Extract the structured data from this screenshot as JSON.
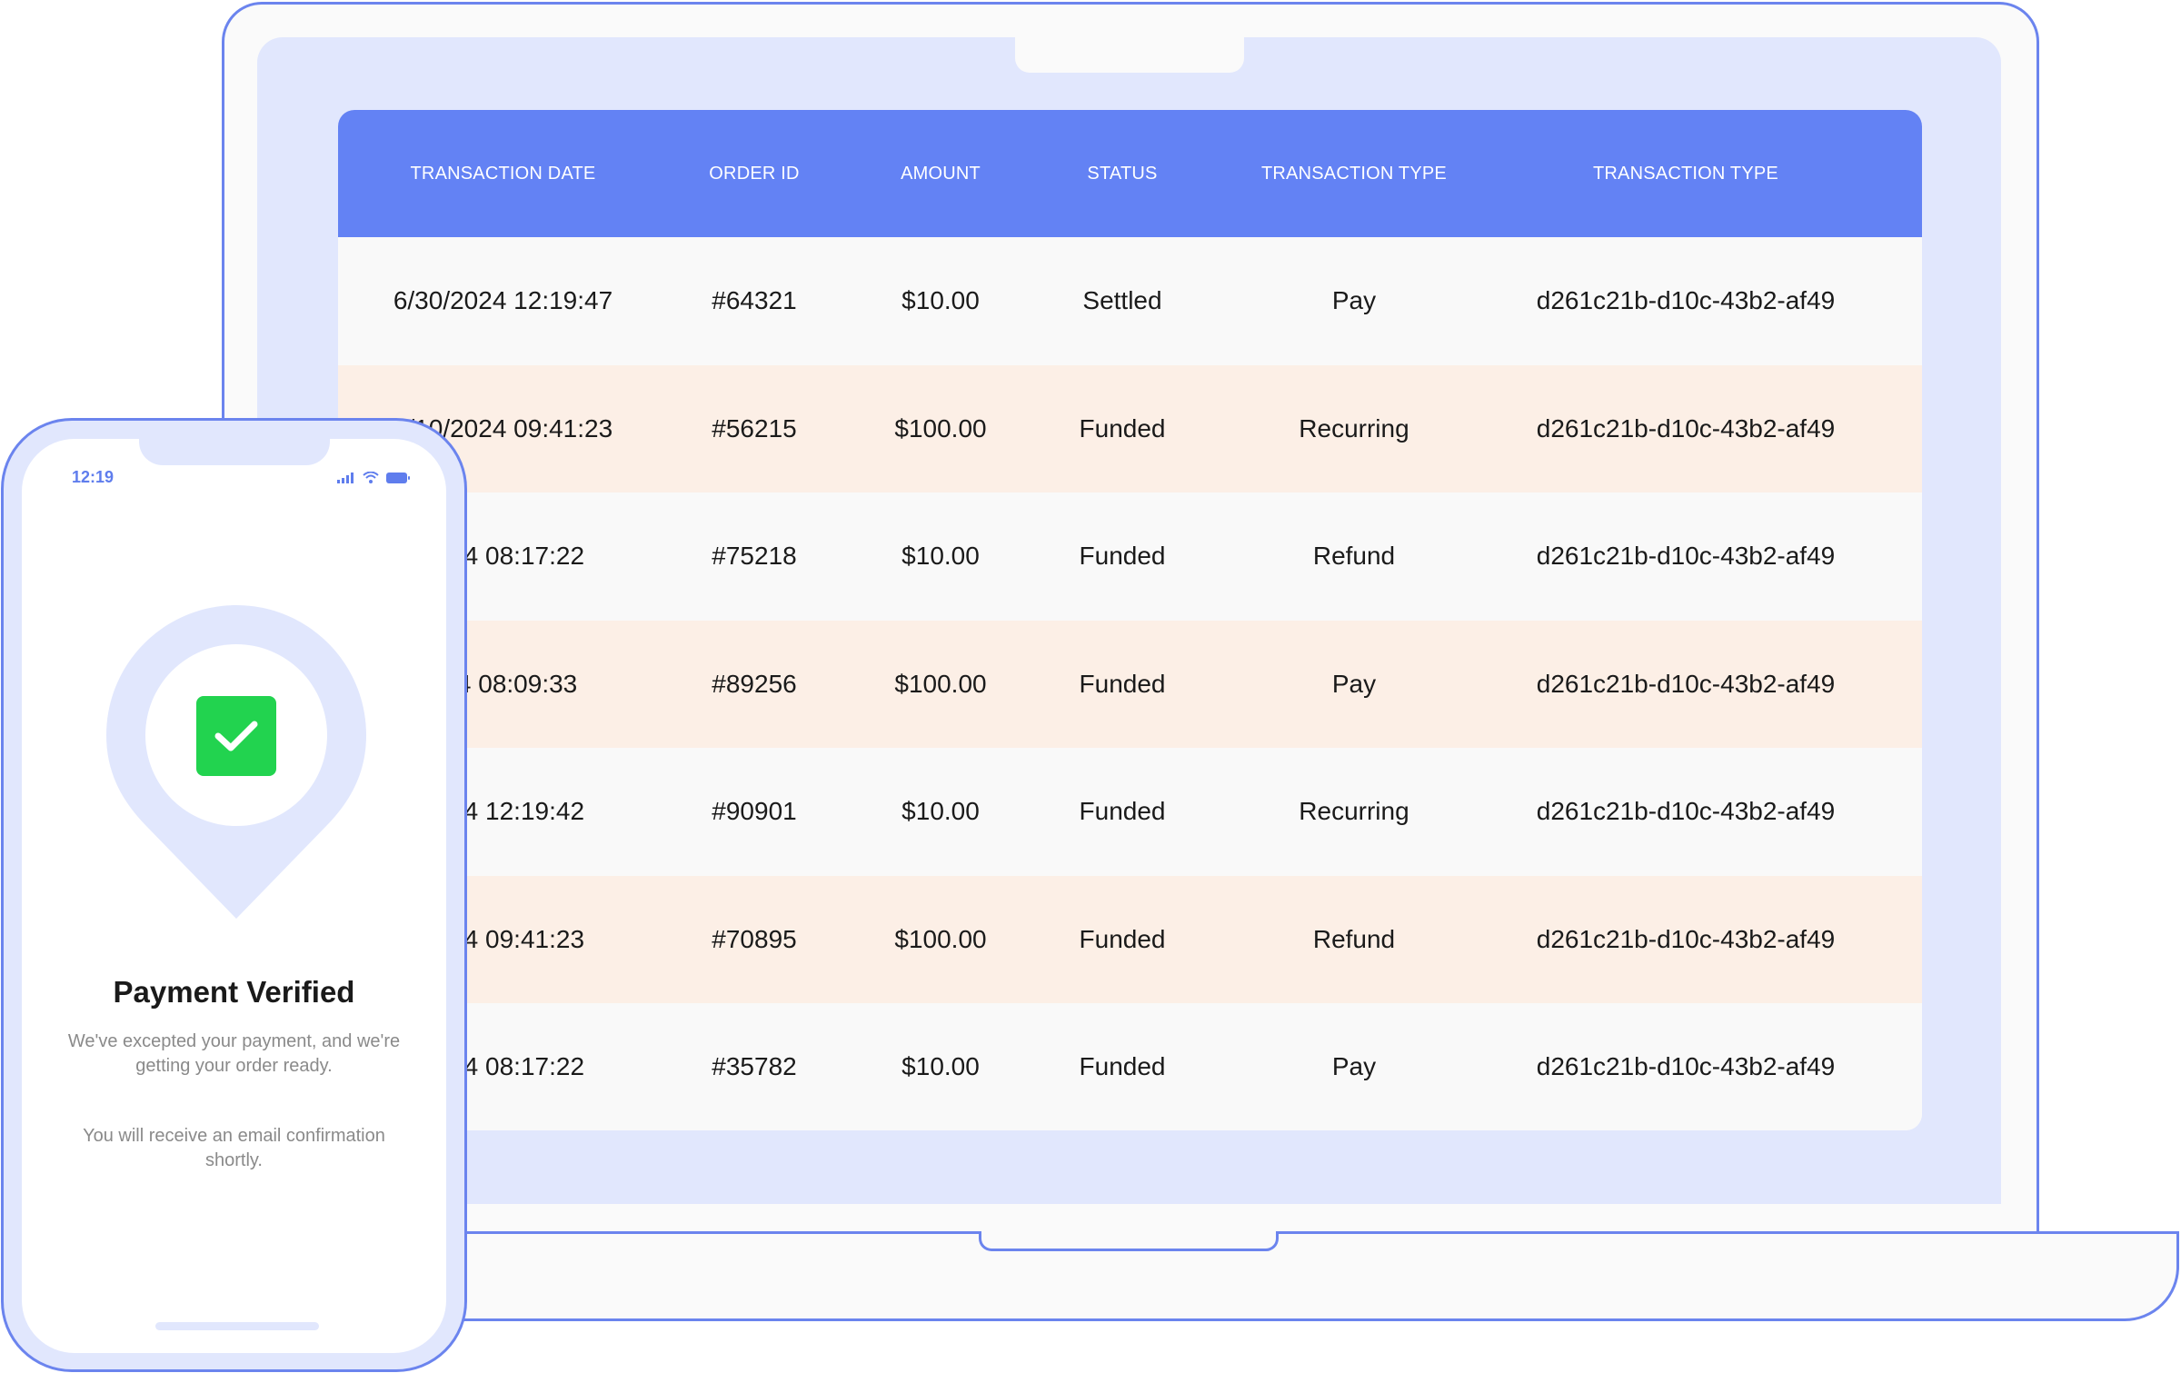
{
  "table": {
    "headers": [
      "TRANSACTION DATE",
      "ORDER ID",
      "AMOUNT",
      "STATUS",
      "TRANSACTION TYPE",
      "TRANSACTION TYPE"
    ],
    "rows": [
      {
        "date": "6/30/2024 12:19:47",
        "order_id": "#64321",
        "amount": "$10.00",
        "status": "Settled",
        "type": "Pay",
        "txn_id": "d261c21b-d10c-43b2-af49"
      },
      {
        "date": "6/10/2024 09:41:23",
        "order_id": "#56215",
        "amount": "$100.00",
        "status": "Funded",
        "type": "Recurring",
        "txn_id": "d261c21b-d10c-43b2-af49"
      },
      {
        "date": "2024 08:17:22",
        "order_id": "#75218",
        "amount": "$10.00",
        "status": "Funded",
        "type": "Refund",
        "txn_id": "d261c21b-d10c-43b2-af49"
      },
      {
        "date": "024 08:09:33",
        "order_id": "#89256",
        "amount": "$100.00",
        "status": "Funded",
        "type": "Pay",
        "txn_id": "d261c21b-d10c-43b2-af49"
      },
      {
        "date": "2024 12:19:42",
        "order_id": "#90901",
        "amount": "$10.00",
        "status": "Funded",
        "type": "Recurring",
        "txn_id": "d261c21b-d10c-43b2-af49"
      },
      {
        "date": "2024 09:41:23",
        "order_id": "#70895",
        "amount": "$100.00",
        "status": "Funded",
        "type": "Refund",
        "txn_id": "d261c21b-d10c-43b2-af49"
      },
      {
        "date": "2024 08:17:22",
        "order_id": "#35782",
        "amount": "$10.00",
        "status": "Funded",
        "type": "Pay",
        "txn_id": "d261c21b-d10c-43b2-af49"
      }
    ]
  },
  "phone": {
    "time": "12:19",
    "title": "Payment Verified",
    "message_1": "We've excepted your payment, and we're getting your order ready.",
    "message_2": "You will receive an email confirmation shortly.",
    "icons": [
      "signal-icon",
      "wifi-icon",
      "battery-icon",
      "location-pin-icon",
      "checkmark-icon"
    ]
  },
  "colors": {
    "header_bg": "#6382f4",
    "row_alt": "#fcefe6",
    "row": "#f9f9f9",
    "device_outline": "#6b84ee",
    "device_fill": "#e1e7fd",
    "success": "#22d34f"
  }
}
